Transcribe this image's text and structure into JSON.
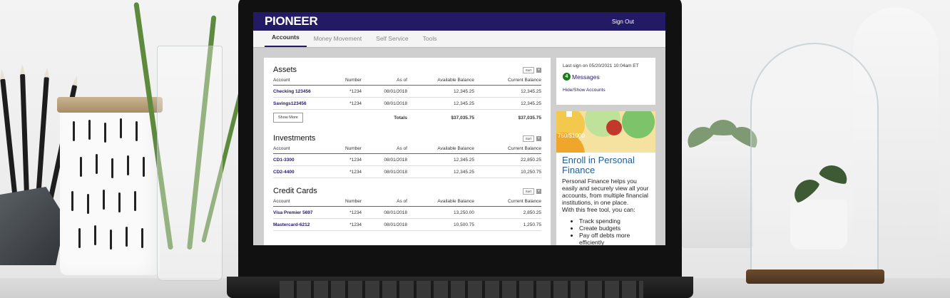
{
  "app": {
    "logo": "PIONEER",
    "sign_out": "Sign Out"
  },
  "nav": {
    "tabs": [
      "Accounts",
      "Money Movement",
      "Self Service",
      "Tools"
    ],
    "active": "Accounts"
  },
  "sort_label": "Sort",
  "columns": [
    "Account",
    "Number",
    "As of",
    "Available Balance",
    "Current Balance"
  ],
  "assets": {
    "title": "Assets",
    "rows": [
      {
        "account": "Checking 123456",
        "number": "*1234",
        "as_of": "08/01/2018",
        "available": "12,345.25",
        "current": "12,345.25"
      },
      {
        "account": "Savings123456",
        "number": "*1234",
        "as_of": "08/01/2018",
        "available": "12,345.25",
        "current": "12,345.25"
      }
    ],
    "show_more": "Show More",
    "totals_label": "Totals",
    "totals_available": "$37,035.75",
    "totals_current": "$37,035.75"
  },
  "investments": {
    "title": "Investments",
    "rows": [
      {
        "account": "CD1-3300",
        "number": "*1234",
        "as_of": "08/01/2018",
        "available": "12,345.25",
        "current": "22,850.25"
      },
      {
        "account": "CD2-4400",
        "number": "*1234",
        "as_of": "08/01/2018",
        "available": "12,345.25",
        "current": "10,250.75"
      }
    ]
  },
  "credit_cards": {
    "title": "Credit Cards",
    "rows": [
      {
        "account": "Visa Premier 5697",
        "number": "*1234",
        "as_of": "08/01/2018",
        "available": "13,250.00",
        "current": "2,850.25"
      },
      {
        "account": "Mastercard-6212",
        "number": "*1234",
        "as_of": "08/01/2018",
        "available": "10,500.75",
        "current": "1,250.75"
      }
    ]
  },
  "sidebar": {
    "last_sign_on": "Last sign on 05/20/2021 10:04am ET",
    "message_count": "4",
    "messages_label": "Messages",
    "hide_show": "Hide/Show Accounts"
  },
  "promo": {
    "amount": "750/$1000",
    "title": "Enroll in Personal Finance",
    "text1": "Personal Finance helps you easily and securely view all your accounts, from multiple financial institutions, in one place.",
    "text2": "With this free tool, you can:",
    "bullets": [
      "Track spending",
      "Create budgets",
      "Pay off debts more efficiently"
    ]
  },
  "colors": {
    "brand": "#231a66",
    "link": "#231a66",
    "badge": "#1f7a1f",
    "promo_title": "#1c5f99"
  }
}
